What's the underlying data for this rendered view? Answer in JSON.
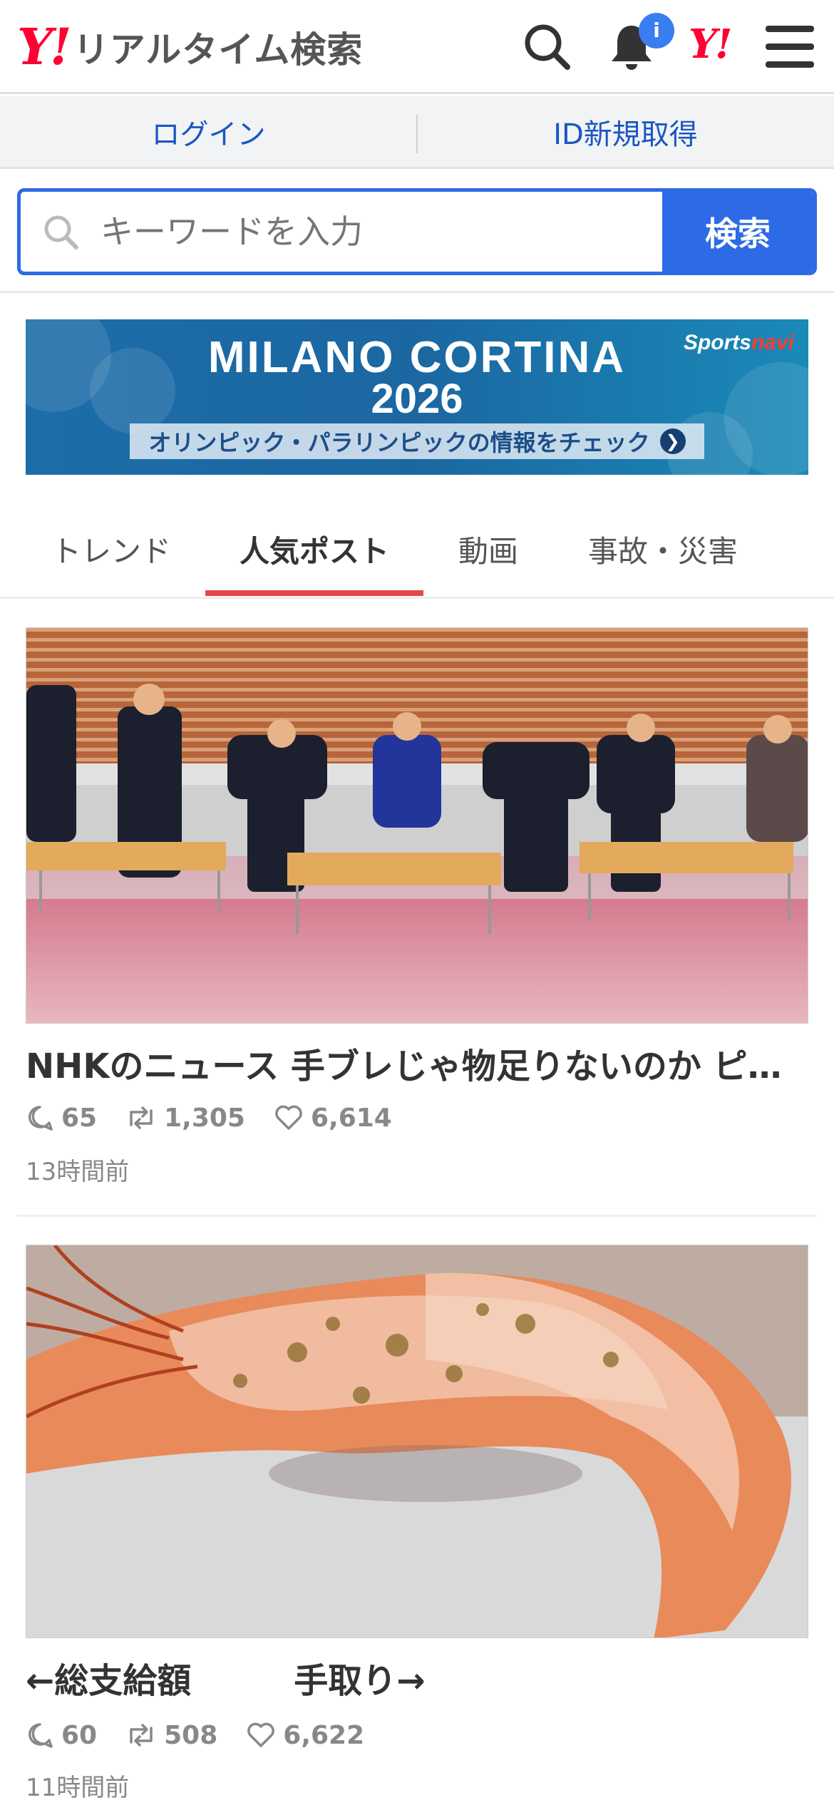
{
  "header": {
    "logo_mark": "Y!",
    "logo_text": "リアルタイム検索",
    "notification_badge": "i",
    "yahoo_mark": "Y!"
  },
  "login_bar": {
    "login_label": "ログイン",
    "register_label": "ID新規取得"
  },
  "search": {
    "placeholder": "キーワードを入力",
    "button_label": "検索"
  },
  "banner": {
    "title": "MILANO CORTINA",
    "year": "2026",
    "subtitle": "オリンピック・パラリンピックの情報をチェック",
    "brand": "Sports",
    "brand_accent": "navi"
  },
  "tabs": [
    {
      "label": "トレンド",
      "active": false
    },
    {
      "label": "人気ポスト",
      "active": true
    },
    {
      "label": "動画",
      "active": false
    },
    {
      "label": "事故・災害",
      "active": false
    }
  ],
  "posts": [
    {
      "title": "NHKのニュース 手ブレじゃ物足りないのか ピ…",
      "replies": "65",
      "reposts": "1,305",
      "likes": "6,614",
      "time": "13時間前"
    },
    {
      "title": "←総支給額　　　手取り→",
      "replies": "60",
      "reposts": "508",
      "likes": "6,622",
      "time": "11時間前"
    }
  ],
  "colors": {
    "brand_red": "#ff0033",
    "accent_blue": "#2d6be6",
    "tab_underline": "#e3474e"
  }
}
